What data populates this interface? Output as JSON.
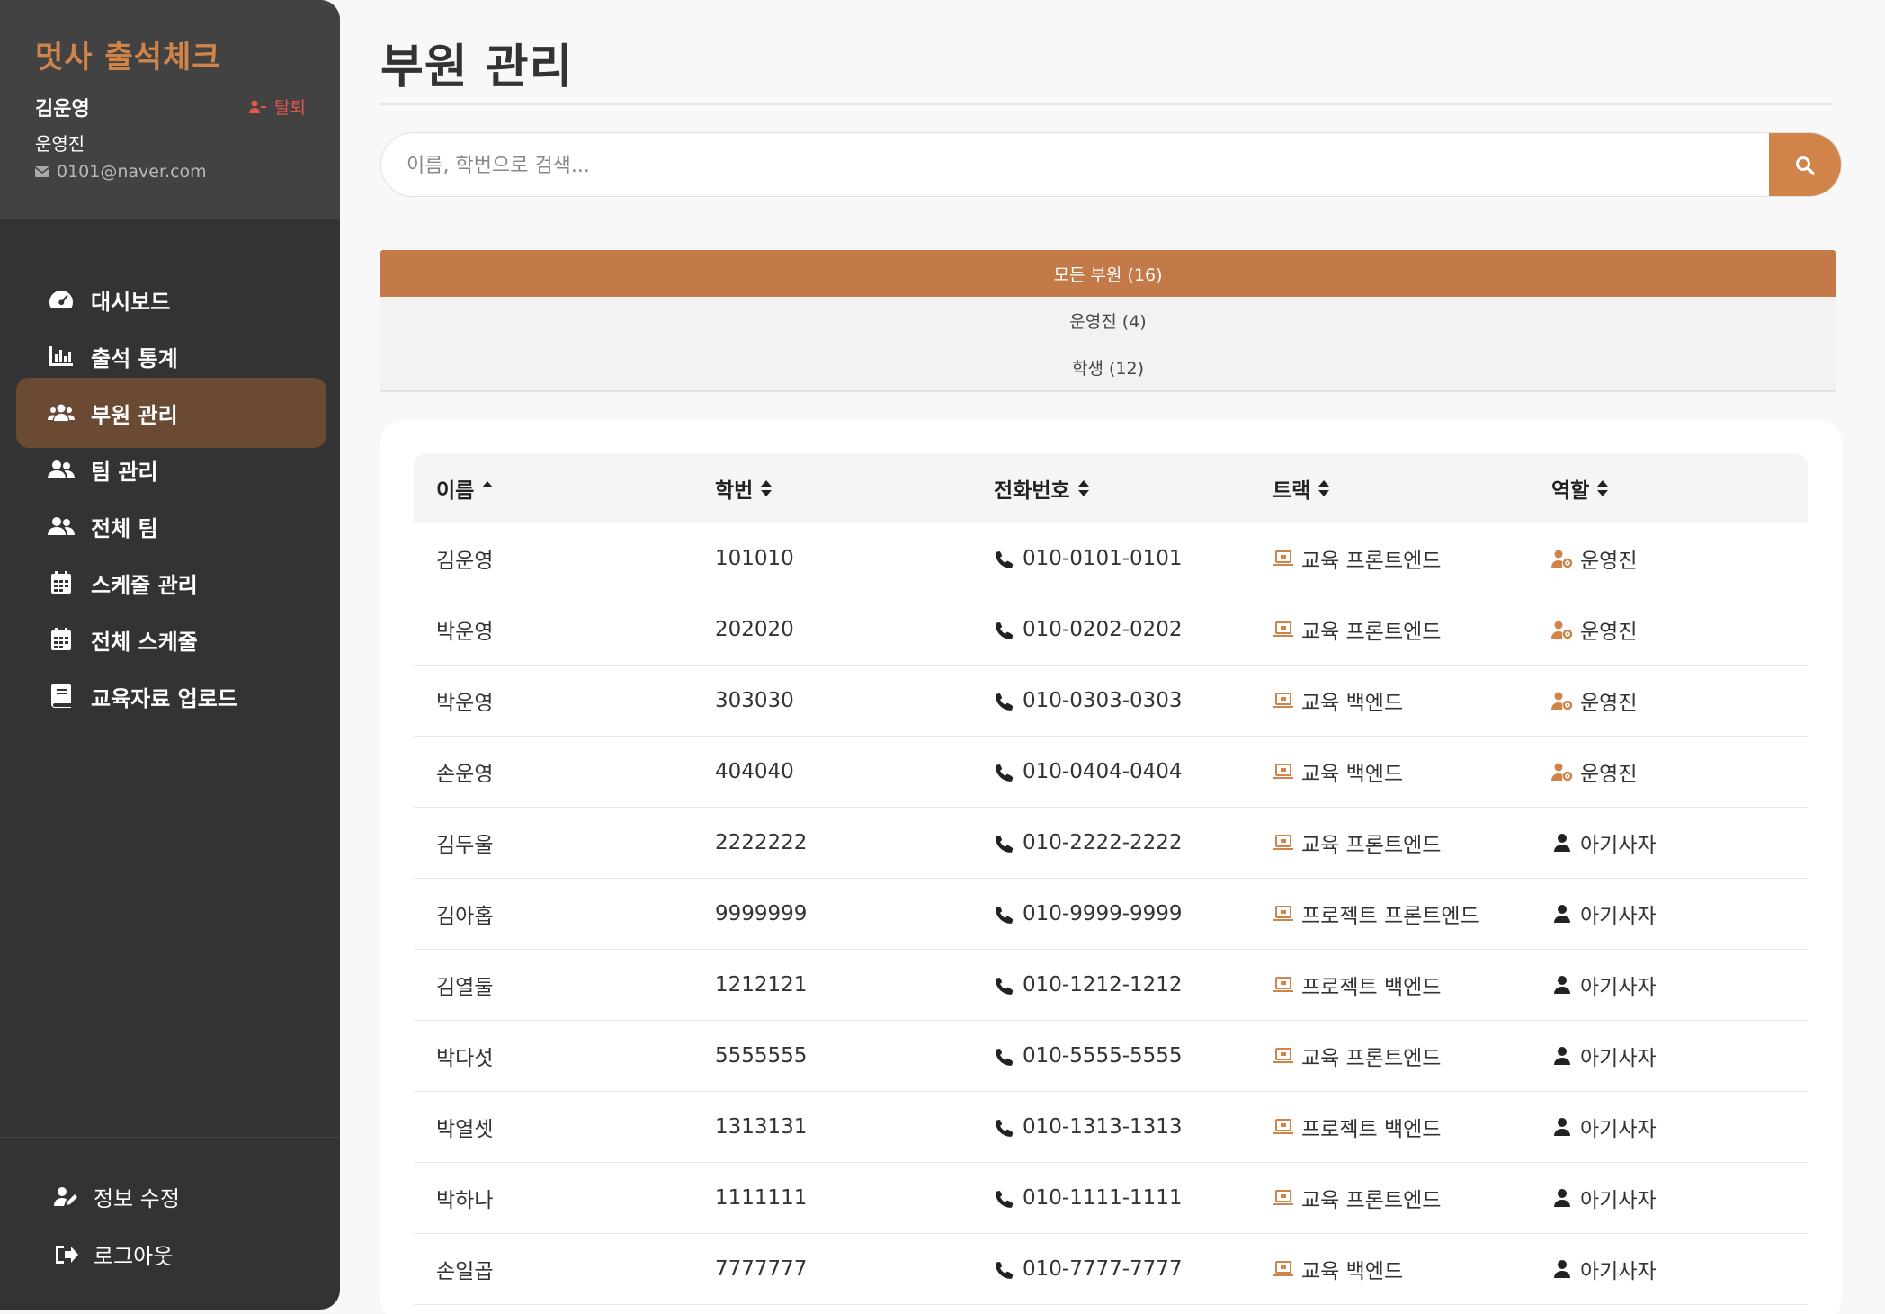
{
  "app": {
    "title": "멋사 출석체크"
  },
  "profile": {
    "name": "김운영",
    "withdraw_label": "탈퇴",
    "role": "운영진",
    "email": "0101@naver.com"
  },
  "nav": {
    "items": [
      {
        "label": "대시보드",
        "icon": "dashboard-icon"
      },
      {
        "label": "출석 통계",
        "icon": "chart-bar-icon"
      },
      {
        "label": "부원 관리",
        "icon": "users-icon",
        "active": true
      },
      {
        "label": "팀 관리",
        "icon": "user-group-icon"
      },
      {
        "label": "전체 팀",
        "icon": "user-group-icon"
      },
      {
        "label": "스케줄 관리",
        "icon": "calendar-icon"
      },
      {
        "label": "전체 스케줄",
        "icon": "calendar-icon"
      },
      {
        "label": "교육자료 업로드",
        "icon": "book-icon"
      }
    ],
    "footer": {
      "edit_profile": "정보 수정",
      "logout": "로그아웃"
    }
  },
  "main": {
    "title": "부원 관리",
    "search": {
      "placeholder": "이름, 학번으로 검색..."
    },
    "filters": [
      {
        "label": "모든 부원 (16)",
        "active": true
      },
      {
        "label": "운영진 (4)"
      },
      {
        "label": "학생 (12)"
      }
    ],
    "table": {
      "columns": [
        "이름",
        "학번",
        "전화번호",
        "트랙",
        "역할"
      ],
      "rows": [
        {
          "name": "김운영",
          "id": "101010",
          "phone": "010-0101-0101",
          "track": "교육 프론트엔드",
          "role": "운영진"
        },
        {
          "name": "박운영",
          "id": "202020",
          "phone": "010-0202-0202",
          "track": "교육 프론트엔드",
          "role": "운영진"
        },
        {
          "name": "박운영",
          "id": "303030",
          "phone": "010-0303-0303",
          "track": "교육 백엔드",
          "role": "운영진"
        },
        {
          "name": "손운영",
          "id": "404040",
          "phone": "010-0404-0404",
          "track": "교육 백엔드",
          "role": "운영진"
        },
        {
          "name": "김두울",
          "id": "2222222",
          "phone": "010-2222-2222",
          "track": "교육 프론트엔드",
          "role": "아기사자"
        },
        {
          "name": "김아홉",
          "id": "9999999",
          "phone": "010-9999-9999",
          "track": "프로젝트 프론트엔드",
          "role": "아기사자"
        },
        {
          "name": "김열둘",
          "id": "1212121",
          "phone": "010-1212-1212",
          "track": "프로젝트 백엔드",
          "role": "아기사자"
        },
        {
          "name": "박다섯",
          "id": "5555555",
          "phone": "010-5555-5555",
          "track": "교육 프론트엔드",
          "role": "아기사자"
        },
        {
          "name": "박열셋",
          "id": "1313131",
          "phone": "010-1313-1313",
          "track": "프로젝트 백엔드",
          "role": "아기사자"
        },
        {
          "name": "박하나",
          "id": "1111111",
          "phone": "010-1111-1111",
          "track": "교육 프론트엔드",
          "role": "아기사자"
        },
        {
          "name": "손일곱",
          "id": "7777777",
          "phone": "010-7777-7777",
          "track": "교육 백엔드",
          "role": "아기사자"
        }
      ]
    }
  },
  "colors": {
    "accent": "#d0844a",
    "accent_dark": "#c47a48",
    "sidebar_bg": "#333333",
    "sidebar_active": "#6b4a33",
    "danger": "#e2564b"
  }
}
